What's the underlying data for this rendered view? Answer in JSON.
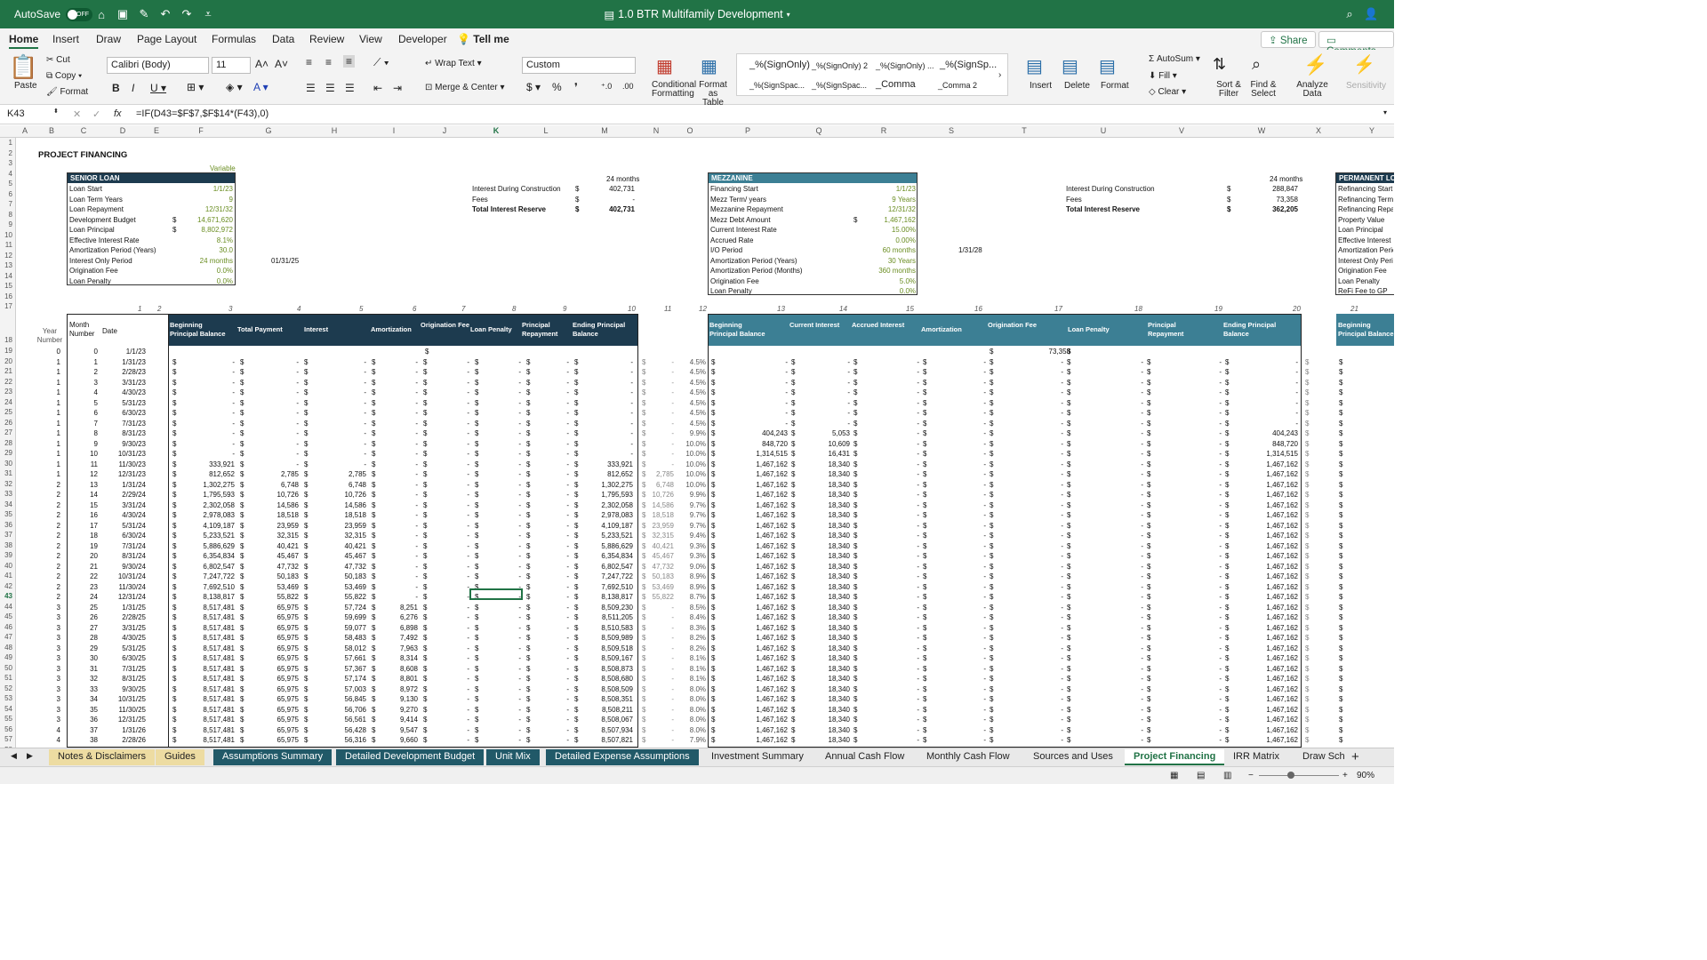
{
  "titlebar": {
    "autosave": "AutoSave",
    "toggle": "OFF",
    "title": "1.0 BTR Multifamily Development"
  },
  "menu": {
    "items": [
      "Home",
      "Insert",
      "Draw",
      "Page Layout",
      "Formulas",
      "Data",
      "Review",
      "View",
      "Developer"
    ],
    "tell_me": "Tell me",
    "share": "Share",
    "comments": "Comments"
  },
  "ribbon": {
    "paste": "Paste",
    "cut": "Cut",
    "copy": "Copy",
    "format": "Format",
    "font": "Calibri (Body)",
    "size": "11",
    "wrap": "Wrap Text",
    "merge": "Merge & Center",
    "numfmt": "Custom",
    "cond": "Conditional Formatting",
    "fmt_table": "Format as Table",
    "styles": [
      "_%(SignOnly)",
      "_%(SignOnly) 2",
      "_%(SignOnly) ...",
      "_%(SignSp...",
      "_%(SignSpac...",
      "_%(SignSpac...",
      "_Comma",
      "_Comma 2"
    ],
    "insert": "Insert",
    "delete": "Delete",
    "format2": "Format",
    "autosum": "AutoSum",
    "fill": "Fill",
    "clear": "Clear",
    "sort": "Sort & Filter",
    "find": "Find & Select",
    "analyze": "Analyze Data",
    "sens": "Sensitivity"
  },
  "formula_bar": {
    "cell_ref": "K43",
    "fx": "fx",
    "formula": "=IF(D43=$F$7,$F$14*(F43),0)"
  },
  "columns": [
    "A",
    "B",
    "C",
    "D",
    "E",
    "F",
    "G",
    "H",
    "I",
    "J",
    "K",
    "L",
    "M",
    "N",
    "O",
    "P",
    "Q",
    "R",
    "S",
    "T",
    "U",
    "V",
    "W",
    "X",
    "Y"
  ],
  "sheet": {
    "title": "PROJECT FINANCING",
    "variable": "Variable",
    "senior": {
      "header": "SENIOR LOAN",
      "rows": [
        [
          "Loan Start",
          "1/1/23",
          ""
        ],
        [
          "Loan Term Years",
          "9",
          ""
        ],
        [
          "Loan Repayment",
          "12/31/32",
          ""
        ],
        [
          "Development Budget",
          "14,671,620",
          "$"
        ],
        [
          "Loan Principal",
          "8,802,972",
          "$"
        ],
        [
          "Effective Interest Rate",
          "8.1%",
          ""
        ],
        [
          "Amortization Period (Years)",
          "30.0",
          ""
        ],
        [
          "Interest Only Period",
          "24 months",
          ""
        ],
        [
          "Origination Fee",
          "0.0%",
          ""
        ],
        [
          "Loan Penalty",
          "0.0%",
          ""
        ]
      ],
      "side_date": "01/31/25"
    },
    "senior_sum": {
      "months": "24 months",
      "rows": [
        [
          "Interest During Construction",
          "$",
          "402,731"
        ],
        [
          "Fees",
          "$",
          "-"
        ],
        [
          "Total Interest Reserve",
          "$",
          "402,731"
        ]
      ]
    },
    "mezz": {
      "header": "MEZZANINE",
      "rows": [
        [
          "Financing Start",
          "1/1/23",
          ""
        ],
        [
          "Mezz Term/ years",
          "9 Years",
          ""
        ],
        [
          "Mezzanine Repayment",
          "12/31/32",
          ""
        ],
        [
          "Mezz Debt Amount",
          "1,467,162",
          "$"
        ],
        [
          "Current Interest Rate",
          "15.00%",
          ""
        ],
        [
          "Accrued Rate",
          "0.00%",
          ""
        ],
        [
          "I/O Period",
          "60 months",
          ""
        ],
        [
          "Amortization Period (Years)",
          "30 Years",
          ""
        ],
        [
          "Amortization Period (Months)",
          "360 months",
          ""
        ],
        [
          "Origination Fee",
          "5.0%",
          ""
        ],
        [
          "Loan Penalty",
          "0.0%",
          ""
        ]
      ],
      "side_date": "1/31/28"
    },
    "mezz_sum": {
      "months": "24 months",
      "rows": [
        [
          "Interest During Construction",
          "$",
          "288,847"
        ],
        [
          "Fees",
          "$",
          "73,358"
        ],
        [
          "Total Interest Reserve",
          "$",
          "362,205"
        ]
      ]
    },
    "perm": {
      "header": "PERMANENT LOAN",
      "rows": [
        "Refinancing Start",
        "Refinancing Term (Y",
        "Refinancing Repaym",
        "Property Value",
        "Loan Principal",
        "Effective Interest Ra",
        "Amortization Period",
        "Interest Only Period",
        "Origination Fee",
        "Loan Penalty",
        "ReFi Fee to GP"
      ]
    },
    "colnums": [
      "1",
      "2",
      "3",
      "4",
      "5",
      "6",
      "7",
      "8",
      "9",
      "10",
      "11",
      "12",
      "13",
      "14",
      "15",
      "16",
      "17",
      "18",
      "19",
      "20",
      "21"
    ],
    "yr_hdr": "Year Number",
    "mo_hdr": "Month Number",
    "date_hdr": "Date",
    "senior_cols": [
      "Beginning Principal Balance",
      "Total Payment",
      "Interest",
      "Amortization",
      "Origination Fee",
      "Loan Penalty",
      "Principal Repayment",
      "Ending Principal Balance"
    ],
    "mezz_cols": [
      "Beginning Principal Balance",
      "Current Interest",
      "Accrued Interest",
      "Amortization",
      "Origination Fee",
      "Loan Penalty",
      "Principal Repayment",
      "Ending Principal Balance"
    ],
    "perm_cols": [
      "Beginning Principal Balance"
    ],
    "rows": [
      [
        "0",
        "0",
        "1/1/23",
        "",
        "",
        "",
        "",
        "",
        "",
        "",
        "",
        "",
        "",
        "",
        "",
        "",
        "",
        "",
        "73,358",
        "",
        "",
        ""
      ],
      [
        "1",
        "1",
        "1/31/23",
        "-",
        "-",
        "-",
        "-",
        "-",
        "-",
        "-",
        "-",
        "-",
        "4.5%",
        "-",
        "-",
        "-",
        "-",
        "-",
        "-",
        "-",
        "-"
      ],
      [
        "1",
        "2",
        "2/28/23",
        "-",
        "-",
        "-",
        "-",
        "-",
        "-",
        "-",
        "-",
        "-",
        "4.5%",
        "-",
        "-",
        "-",
        "-",
        "-",
        "-",
        "-",
        "-"
      ],
      [
        "1",
        "3",
        "3/31/23",
        "-",
        "-",
        "-",
        "-",
        "-",
        "-",
        "-",
        "-",
        "-",
        "4.5%",
        "-",
        "-",
        "-",
        "-",
        "-",
        "-",
        "-",
        "-"
      ],
      [
        "1",
        "4",
        "4/30/23",
        "-",
        "-",
        "-",
        "-",
        "-",
        "-",
        "-",
        "-",
        "-",
        "4.5%",
        "-",
        "-",
        "-",
        "-",
        "-",
        "-",
        "-",
        "-"
      ],
      [
        "1",
        "5",
        "5/31/23",
        "-",
        "-",
        "-",
        "-",
        "-",
        "-",
        "-",
        "-",
        "-",
        "4.5%",
        "-",
        "-",
        "-",
        "-",
        "-",
        "-",
        "-",
        "-"
      ],
      [
        "1",
        "6",
        "6/30/23",
        "-",
        "-",
        "-",
        "-",
        "-",
        "-",
        "-",
        "-",
        "-",
        "4.5%",
        "-",
        "-",
        "-",
        "-",
        "-",
        "-",
        "-",
        "-"
      ],
      [
        "1",
        "7",
        "7/31/23",
        "-",
        "-",
        "-",
        "-",
        "-",
        "-",
        "-",
        "-",
        "-",
        "4.5%",
        "-",
        "-",
        "-",
        "-",
        "-",
        "-",
        "-",
        "-"
      ],
      [
        "1",
        "8",
        "8/31/23",
        "-",
        "-",
        "-",
        "-",
        "-",
        "-",
        "-",
        "-",
        "-",
        "9.9%",
        "404,243",
        "5,053",
        "-",
        "-",
        "-",
        "-",
        "-",
        "404,243"
      ],
      [
        "1",
        "9",
        "9/30/23",
        "-",
        "-",
        "-",
        "-",
        "-",
        "-",
        "-",
        "-",
        "-",
        "10.0%",
        "848,720",
        "10,609",
        "-",
        "-",
        "-",
        "-",
        "-",
        "848,720"
      ],
      [
        "1",
        "10",
        "10/31/23",
        "-",
        "-",
        "-",
        "-",
        "-",
        "-",
        "-",
        "-",
        "-",
        "10.0%",
        "1,314,515",
        "16,431",
        "-",
        "-",
        "-",
        "-",
        "-",
        "1,314,515"
      ],
      [
        "1",
        "11",
        "11/30/23",
        "333,921",
        "-",
        "-",
        "-",
        "-",
        "-",
        "-",
        "333,921",
        "-",
        "10.0%",
        "1,467,162",
        "18,340",
        "-",
        "-",
        "-",
        "-",
        "-",
        "1,467,162"
      ],
      [
        "1",
        "12",
        "12/31/23",
        "812,652",
        "2,785",
        "2,785",
        "-",
        "-",
        "-",
        "-",
        "812,652",
        "2,785",
        "10.0%",
        "1,467,162",
        "18,340",
        "-",
        "-",
        "-",
        "-",
        "-",
        "1,467,162"
      ],
      [
        "2",
        "13",
        "1/31/24",
        "1,302,275",
        "6,748",
        "6,748",
        "-",
        "-",
        "-",
        "-",
        "1,302,275",
        "6,748",
        "10.0%",
        "1,467,162",
        "18,340",
        "-",
        "-",
        "-",
        "-",
        "-",
        "1,467,162"
      ],
      [
        "2",
        "14",
        "2/29/24",
        "1,795,593",
        "10,726",
        "10,726",
        "-",
        "-",
        "-",
        "-",
        "1,795,593",
        "10,726",
        "9.9%",
        "1,467,162",
        "18,340",
        "-",
        "-",
        "-",
        "-",
        "-",
        "1,467,162"
      ],
      [
        "2",
        "15",
        "3/31/24",
        "2,302,058",
        "14,586",
        "14,586",
        "-",
        "-",
        "-",
        "-",
        "2,302,058",
        "14,586",
        "9.7%",
        "1,467,162",
        "18,340",
        "-",
        "-",
        "-",
        "-",
        "-",
        "1,467,162"
      ],
      [
        "2",
        "16",
        "4/30/24",
        "2,978,083",
        "18,518",
        "18,518",
        "-",
        "-",
        "-",
        "-",
        "2,978,083",
        "18,518",
        "9.7%",
        "1,467,162",
        "18,340",
        "-",
        "-",
        "-",
        "-",
        "-",
        "1,467,162"
      ],
      [
        "2",
        "17",
        "5/31/24",
        "4,109,187",
        "23,959",
        "23,959",
        "-",
        "-",
        "-",
        "-",
        "4,109,187",
        "23,959",
        "9.7%",
        "1,467,162",
        "18,340",
        "-",
        "-",
        "-",
        "-",
        "-",
        "1,467,162"
      ],
      [
        "2",
        "18",
        "6/30/24",
        "5,233,521",
        "32,315",
        "32,315",
        "-",
        "-",
        "-",
        "-",
        "5,233,521",
        "32,315",
        "9.4%",
        "1,467,162",
        "18,340",
        "-",
        "-",
        "-",
        "-",
        "-",
        "1,467,162"
      ],
      [
        "2",
        "19",
        "7/31/24",
        "5,886,629",
        "40,421",
        "40,421",
        "-",
        "-",
        "-",
        "-",
        "5,886,629",
        "40,421",
        "9.3%",
        "1,467,162",
        "18,340",
        "-",
        "-",
        "-",
        "-",
        "-",
        "1,467,162"
      ],
      [
        "2",
        "20",
        "8/31/24",
        "6,354,834",
        "45,467",
        "45,467",
        "-",
        "-",
        "-",
        "-",
        "6,354,834",
        "45,467",
        "9.3%",
        "1,467,162",
        "18,340",
        "-",
        "-",
        "-",
        "-",
        "-",
        "1,467,162"
      ],
      [
        "2",
        "21",
        "9/30/24",
        "6,802,547",
        "47,732",
        "47,732",
        "-",
        "-",
        "-",
        "-",
        "6,802,547",
        "47,732",
        "9.0%",
        "1,467,162",
        "18,340",
        "-",
        "-",
        "-",
        "-",
        "-",
        "1,467,162"
      ],
      [
        "2",
        "22",
        "10/31/24",
        "7,247,722",
        "50,183",
        "50,183",
        "-",
        "-",
        "-",
        "-",
        "7,247,722",
        "50,183",
        "8.9%",
        "1,467,162",
        "18,340",
        "-",
        "-",
        "-",
        "-",
        "-",
        "1,467,162"
      ],
      [
        "2",
        "23",
        "11/30/24",
        "7,692,510",
        "53,469",
        "53,469",
        "-",
        "-",
        "-",
        "-",
        "7,692,510",
        "53,469",
        "8.9%",
        "1,467,162",
        "18,340",
        "-",
        "-",
        "-",
        "-",
        "-",
        "1,467,162"
      ],
      [
        "2",
        "24",
        "12/31/24",
        "8,138,817",
        "55,822",
        "55,822",
        "-",
        "-",
        "-",
        "-",
        "8,138,817",
        "55,822",
        "8.7%",
        "1,467,162",
        "18,340",
        "-",
        "-",
        "-",
        "-",
        "-",
        "1,467,162"
      ],
      [
        "3",
        "25",
        "1/31/25",
        "8,517,481",
        "65,975",
        "57,724",
        "8,251",
        "-",
        "-",
        "-",
        "8,509,230",
        "-",
        "8.5%",
        "1,467,162",
        "18,340",
        "-",
        "-",
        "-",
        "-",
        "-",
        "1,467,162"
      ],
      [
        "3",
        "26",
        "2/28/25",
        "8,517,481",
        "65,975",
        "59,699",
        "6,276",
        "-",
        "-",
        "-",
        "8,511,205",
        "-",
        "8.4%",
        "1,467,162",
        "18,340",
        "-",
        "-",
        "-",
        "-",
        "-",
        "1,467,162"
      ],
      [
        "3",
        "27",
        "3/31/25",
        "8,517,481",
        "65,975",
        "59,077",
        "6,898",
        "-",
        "-",
        "-",
        "8,510,583",
        "-",
        "8.3%",
        "1,467,162",
        "18,340",
        "-",
        "-",
        "-",
        "-",
        "-",
        "1,467,162"
      ],
      [
        "3",
        "28",
        "4/30/25",
        "8,517,481",
        "65,975",
        "58,483",
        "7,492",
        "-",
        "-",
        "-",
        "8,509,989",
        "-",
        "8.2%",
        "1,467,162",
        "18,340",
        "-",
        "-",
        "-",
        "-",
        "-",
        "1,467,162"
      ],
      [
        "3",
        "29",
        "5/31/25",
        "8,517,481",
        "65,975",
        "58,012",
        "7,963",
        "-",
        "-",
        "-",
        "8,509,518",
        "-",
        "8.2%",
        "1,467,162",
        "18,340",
        "-",
        "-",
        "-",
        "-",
        "-",
        "1,467,162"
      ],
      [
        "3",
        "30",
        "6/30/25",
        "8,517,481",
        "65,975",
        "57,661",
        "8,314",
        "-",
        "-",
        "-",
        "8,509,167",
        "-",
        "8.1%",
        "1,467,162",
        "18,340",
        "-",
        "-",
        "-",
        "-",
        "-",
        "1,467,162"
      ],
      [
        "3",
        "31",
        "7/31/25",
        "8,517,481",
        "65,975",
        "57,367",
        "8,608",
        "-",
        "-",
        "-",
        "8,508,873",
        "-",
        "8.1%",
        "1,467,162",
        "18,340",
        "-",
        "-",
        "-",
        "-",
        "-",
        "1,467,162"
      ],
      [
        "3",
        "32",
        "8/31/25",
        "8,517,481",
        "65,975",
        "57,174",
        "8,801",
        "-",
        "-",
        "-",
        "8,508,680",
        "-",
        "8.1%",
        "1,467,162",
        "18,340",
        "-",
        "-",
        "-",
        "-",
        "-",
        "1,467,162"
      ],
      [
        "3",
        "33",
        "9/30/25",
        "8,517,481",
        "65,975",
        "57,003",
        "8,972",
        "-",
        "-",
        "-",
        "8,508,509",
        "-",
        "8.0%",
        "1,467,162",
        "18,340",
        "-",
        "-",
        "-",
        "-",
        "-",
        "1,467,162"
      ],
      [
        "3",
        "34",
        "10/31/25",
        "8,517,481",
        "65,975",
        "56,845",
        "9,130",
        "-",
        "-",
        "-",
        "8,508,351",
        "-",
        "8.0%",
        "1,467,162",
        "18,340",
        "-",
        "-",
        "-",
        "-",
        "-",
        "1,467,162"
      ],
      [
        "3",
        "35",
        "11/30/25",
        "8,517,481",
        "65,975",
        "56,706",
        "9,270",
        "-",
        "-",
        "-",
        "8,508,211",
        "-",
        "8.0%",
        "1,467,162",
        "18,340",
        "-",
        "-",
        "-",
        "-",
        "-",
        "1,467,162"
      ],
      [
        "3",
        "36",
        "12/31/25",
        "8,517,481",
        "65,975",
        "56,561",
        "9,414",
        "-",
        "-",
        "-",
        "8,508,067",
        "-",
        "8.0%",
        "1,467,162",
        "18,340",
        "-",
        "-",
        "-",
        "-",
        "-",
        "1,467,162"
      ],
      [
        "4",
        "37",
        "1/31/26",
        "8,517,481",
        "65,975",
        "56,428",
        "9,547",
        "-",
        "-",
        "-",
        "8,507,934",
        "-",
        "8.0%",
        "1,467,162",
        "18,340",
        "-",
        "-",
        "-",
        "-",
        "-",
        "1,467,162"
      ],
      [
        "4",
        "38",
        "2/28/26",
        "8,517,481",
        "65,975",
        "56,316",
        "9,660",
        "-",
        "-",
        "-",
        "8,507,821",
        "-",
        "7.9%",
        "1,467,162",
        "18,340",
        "-",
        "-",
        "-",
        "-",
        "-",
        "1,467,162"
      ]
    ]
  },
  "tabs": [
    {
      "label": "Notes & Disclaimers",
      "style": "green"
    },
    {
      "label": "Guides",
      "style": "green"
    },
    {
      "label": "Assumptions Summary",
      "style": "blue"
    },
    {
      "label": "Detailed Development Budget",
      "style": "blue"
    },
    {
      "label": "Unit Mix",
      "style": "blue"
    },
    {
      "label": "Detailed Expense Assumptions",
      "style": "blue"
    },
    {
      "label": "Investment Summary",
      "style": "plain"
    },
    {
      "label": "Annual Cash Flow",
      "style": "plain"
    },
    {
      "label": "Monthly Cash Flow",
      "style": "plain"
    },
    {
      "label": "Sources and Uses",
      "style": "plain"
    },
    {
      "label": "Project Financing",
      "style": "active"
    },
    {
      "label": "IRR Matrix",
      "style": "plain"
    },
    {
      "label": "Draw Sch",
      "style": "plain"
    }
  ],
  "status": {
    "zoom": "90%"
  },
  "colors": {
    "excel_green": "#217346",
    "header_dark": "#1d3b4f",
    "header_mezz": "#3c7f94",
    "accent_olive": "#6b8e23"
  }
}
